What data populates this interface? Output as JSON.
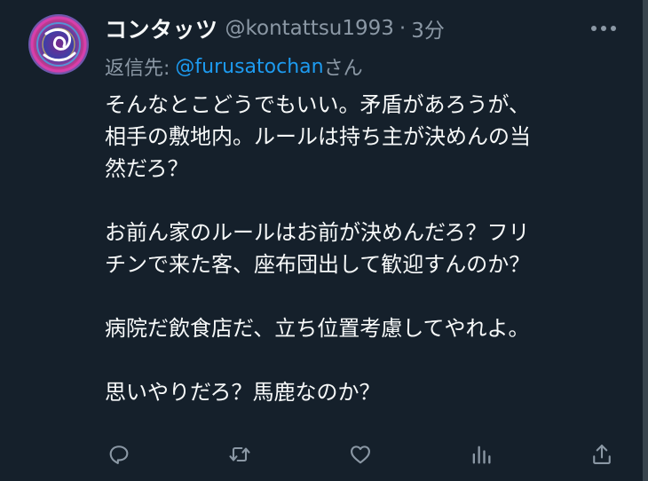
{
  "tweet": {
    "display_name": "コンタッツ",
    "handle": "@kontattsu1993",
    "separator": "·",
    "timestamp": "3分",
    "reply_prefix": "返信先:",
    "reply_mention": "@furusatochan",
    "reply_suffix": "さん",
    "text_lines": [
      "そんなとこどうでもいい。矛盾があろうが、",
      "相手の敷地内。ルールは持ち主が決めんの当",
      "然だろ？",
      "",
      "お前ん家のルールはお前が決めんだろ？フリ",
      "チンで来た客、座布団出して歓迎すんのか？",
      "",
      "病院だ飲食店だ、立ち位置考慮してやれよ。",
      "",
      "思いやりだろ？馬鹿なのか？"
    ]
  },
  "icons": {
    "avatar": "avatar-image",
    "more": "more-icon",
    "reply": "reply-icon",
    "retweet": "retweet-icon",
    "like": "like-icon",
    "views": "views-icon",
    "share": "share-icon"
  },
  "colors": {
    "background": "#15202b",
    "text_primary": "#f7f9f9",
    "text_secondary": "#8b98a5",
    "accent": "#1d9bf0",
    "border": "#38444d"
  }
}
